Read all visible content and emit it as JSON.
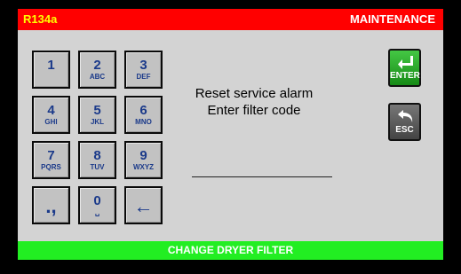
{
  "header": {
    "refrigerant": "R134a",
    "mode": "MAINTENANCE"
  },
  "keypad": [
    {
      "main": "1",
      "sub": ""
    },
    {
      "main": "2",
      "sub": "ABC"
    },
    {
      "main": "3",
      "sub": "DEF"
    },
    {
      "main": "4",
      "sub": "GHI"
    },
    {
      "main": "5",
      "sub": "JKL"
    },
    {
      "main": "6",
      "sub": "MNO"
    },
    {
      "main": "7",
      "sub": "PQRS"
    },
    {
      "main": "8",
      "sub": "TUV"
    },
    {
      "main": "9",
      "sub": "WXYZ"
    },
    {
      "main": ".,",
      "sub": ""
    },
    {
      "main": "0",
      "sub": "␣"
    },
    {
      "main": "←",
      "sub": ""
    }
  ],
  "message": {
    "line1": "Reset service alarm",
    "line2": "Enter filter code"
  },
  "buttons": {
    "enter": "ENTER",
    "esc": "ESC"
  },
  "footer": {
    "status": "CHANGE DRYER FILTER"
  },
  "colors": {
    "header_bg": "#ff0000",
    "header_text": "#ffff00",
    "footer_bg": "#22ee22",
    "key_text": "#1b3a8a",
    "enter_bg": "#2aa52a",
    "esc_bg": "#555555"
  }
}
